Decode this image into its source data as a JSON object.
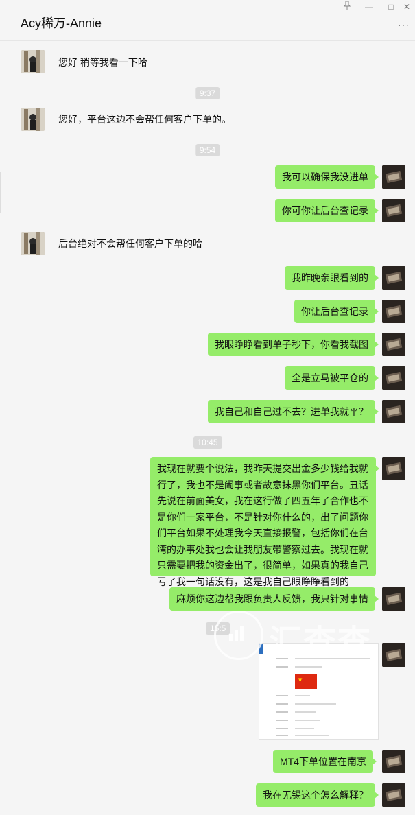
{
  "window": {
    "title": "Acy稀万-Annie",
    "pin_icon": "pin-icon",
    "minimize": "—",
    "maximize": "□",
    "close": "✕",
    "more": "···"
  },
  "timestamps": [
    "9:37",
    "9:54",
    "10:45",
    "15:5"
  ],
  "messages": {
    "m1": "您好 稍等我看一下哈",
    "m2": "您好，平台这边不会帮任何客户下单的。",
    "m3": "我可以确保我没进单",
    "m4": "你可你让后台查记录",
    "m5": "后台绝对不会帮任何客户下单的哈",
    "m6": "我昨晚亲眼看到的",
    "m7": "你让后台查记录",
    "m8": "我眼睁睁看到单子秒下，你看我截图",
    "m9": "全是立马被平仓的",
    "m10": "我自己和自己过不去？进单我就平？",
    "m11": "我现在就要个说法，我昨天提交出金多少钱给我就行了，我也不是闹事或者故意抹黑你们平台。丑话先说在前面美女，我在这行做了四五年了合作也不是你们一家平台，不是针对你什么的，出了问题你们平台如果不处理我今天直接报警，包括你们在台湾的办事处我也会让我朋友带警察过去。我现在就只需要把我的资金出了，很简单，如果真的我自己亏了我一句话没有，这是我自己眼睁睁看到的",
    "m12": "麻烦你这边帮我跟负责人反馈，我只针对事情",
    "m13": "MT4下单位置在南京",
    "m14": "我在无锡这个怎么解释？"
  },
  "watermark": "汇查查",
  "colors": {
    "bubble_self": "#95ec69",
    "background": "#f5f5f5",
    "timestamp_bg": "#dadada"
  }
}
